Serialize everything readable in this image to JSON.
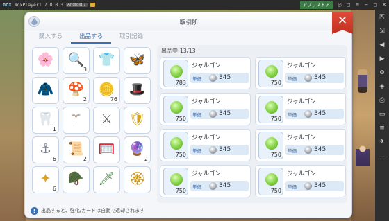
{
  "emulator": {
    "logo": "nox",
    "title": "NoxPlayer1 7.0.0.3",
    "badge": "Android 7",
    "store_label": "アプリストア",
    "top_icons": [
      "◎",
      "◻",
      "≡",
      "−",
      "◻",
      "✕"
    ],
    "side_icons": [
      "⇱",
      "⇲",
      "◀",
      "▶",
      "⊙",
      "◈",
      "⎙",
      "▭",
      "≡",
      "✈",
      "…"
    ]
  },
  "panel": {
    "title": "取引所",
    "close_label": "✕"
  },
  "tabs": [
    {
      "label": "購入する",
      "active": false
    },
    {
      "label": "出品する",
      "active": true
    },
    {
      "label": "取引記録",
      "active": false
    }
  ],
  "inventory": [
    {
      "icon": "pink-rose-icon",
      "glyph": "🌸",
      "qty": "",
      "color": "#e67a9c"
    },
    {
      "icon": "magnifier-icon",
      "glyph": "🔍",
      "qty": "3",
      "color": "#8a6a3a"
    },
    {
      "icon": "green-armor-icon",
      "glyph": "👕",
      "qty": "",
      "color": "#5f8f5a"
    },
    {
      "icon": "wing-icon",
      "glyph": "🦋",
      "qty": "",
      "color": "#b07ac0"
    },
    {
      "icon": "purple-cloak-icon",
      "glyph": "🧥",
      "qty": "",
      "color": "#b08ad0"
    },
    {
      "icon": "mushroom-icon",
      "glyph": "🍄",
      "qty": "2",
      "color": "#9aa0a8"
    },
    {
      "icon": "gold-ingot-icon",
      "glyph": "🪙",
      "qty": "76",
      "color": "#e0b030"
    },
    {
      "icon": "pirate-hat-icon",
      "glyph": "🎩",
      "qty": "",
      "color": "#c0306a"
    },
    {
      "icon": "fang-icon",
      "glyph": "🦷",
      "qty": "1",
      "color": "#e0b070"
    },
    {
      "icon": "staff-icon",
      "glyph": "⚚",
      "qty": "",
      "color": "#6a5a4a"
    },
    {
      "icon": "wand-icon",
      "glyph": "⚔",
      "qty": "",
      "color": "#5a5a5a"
    },
    {
      "icon": "gold-shield-icon",
      "glyph": "🛡",
      "qty": "",
      "color": "#d0a020"
    },
    {
      "icon": "hook-icon",
      "glyph": "⚓",
      "qty": "6",
      "color": "#7a8290"
    },
    {
      "icon": "scroll-icon",
      "glyph": "📜",
      "qty": "2",
      "color": "#a07040"
    },
    {
      "icon": "bug-net-icon",
      "glyph": "🥅",
      "qty": "",
      "color": "#b06a30"
    },
    {
      "icon": "pink-orb-icon",
      "glyph": "🔮",
      "qty": "2",
      "color": "#e08aa0"
    },
    {
      "icon": "gold-crest-icon",
      "glyph": "✦",
      "qty": "6",
      "color": "#e0a020"
    },
    {
      "icon": "camo-armor-icon",
      "glyph": "🪖",
      "qty": "",
      "color": "#6a7a4a"
    },
    {
      "icon": "green-rod-icon",
      "glyph": "🗡",
      "qty": "",
      "color": "#5a8a5a"
    },
    {
      "icon": "gold-badge-icon",
      "glyph": "🏵",
      "qty": "",
      "color": "#d09a20"
    }
  ],
  "listing": {
    "count_label": "出品中:13/13",
    "price_label": "単価",
    "items": [
      {
        "name": "ジャルゴン",
        "qty": "783",
        "price": "345"
      },
      {
        "name": "ジャルゴン",
        "qty": "750",
        "price": "345"
      },
      {
        "name": "ジャルゴン",
        "qty": "750",
        "price": "345"
      },
      {
        "name": "ジャルゴン",
        "qty": "750",
        "price": "345"
      },
      {
        "name": "ジャルゴン",
        "qty": "750",
        "price": "345"
      },
      {
        "name": "ジャルゴン",
        "qty": "750",
        "price": "345"
      },
      {
        "name": "ジャルゴン",
        "qty": "750",
        "price": "345"
      },
      {
        "name": "ジャルゴン",
        "qty": "750",
        "price": "345"
      }
    ]
  },
  "footer": {
    "hint_icon": "!",
    "hint_text": "出品すると、強化/カードは自動で返却されます"
  },
  "colors": {
    "accent": "#3b6fb4",
    "close": "#d83c2c",
    "orb": "#7ccc3c"
  }
}
